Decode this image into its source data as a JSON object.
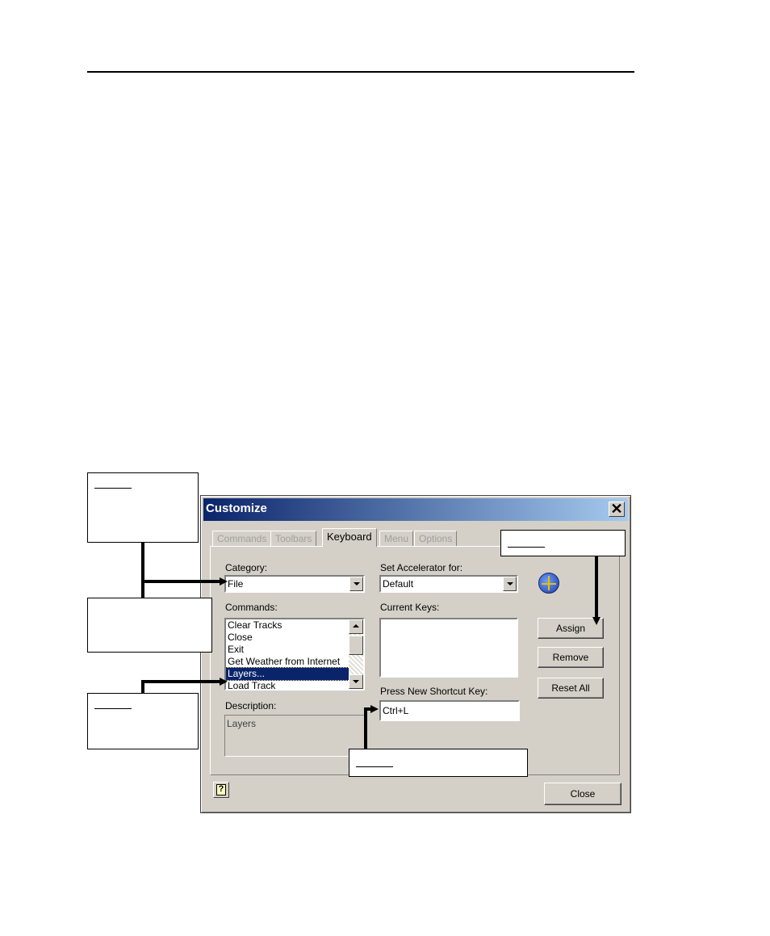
{
  "dialog": {
    "title": "Customize",
    "close_glyph": "✕",
    "tabs": [
      "Commands",
      "Toolbars",
      "Keyboard",
      "Menu",
      "Options"
    ],
    "active_tab": "Keyboard",
    "category": {
      "label": "Category:",
      "value": "File"
    },
    "accelerator": {
      "label": "Set Accelerator for:",
      "value": "Default"
    },
    "commands": {
      "label": "Commands:",
      "items": [
        "Clear Tracks",
        "Close",
        "Exit",
        "Get Weather from Internet",
        "Layers...",
        "Load Track"
      ],
      "selected_index": 4
    },
    "current_keys": {
      "label": "Current Keys:"
    },
    "shortcut": {
      "label": "Press New Shortcut Key:",
      "value": "Ctrl+L"
    },
    "description": {
      "label": "Description:",
      "value": "Layers"
    },
    "buttons": {
      "assign": "Assign",
      "remove": "Remove",
      "reset_all": "Reset All",
      "close": "Close"
    },
    "help_glyph": "?",
    "icons": [
      "globe-icon",
      "help-icon",
      "close-icon",
      "chevron-down-icon"
    ]
  },
  "colors": {
    "title_start": "#0a246a",
    "title_end": "#a6caf0",
    "dialog_bg": "#d4d0c8",
    "selection": "#0a246a"
  }
}
